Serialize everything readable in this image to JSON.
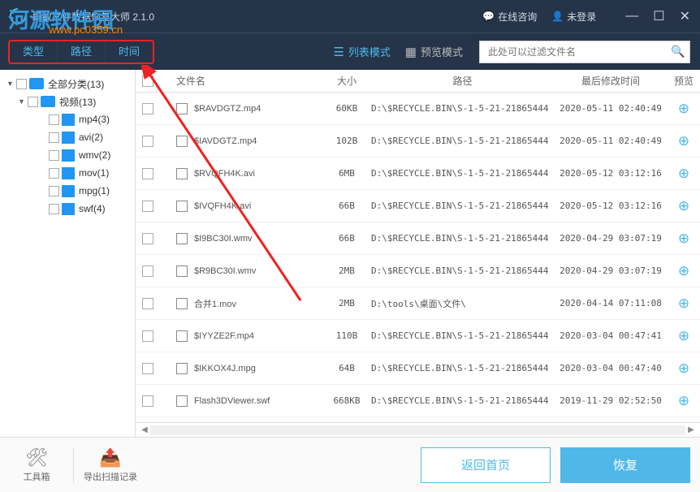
{
  "titlebar": {
    "title": "蚂蚁文件数据恢复大师 2.1.0",
    "online_consult": "在线咨询",
    "login_status": "未登录"
  },
  "watermark": {
    "main": "河源软件园",
    "url": "www.pc0359.cn"
  },
  "filter_tabs": [
    "类型",
    "路径",
    "时间"
  ],
  "modes": {
    "list": "列表模式",
    "preview": "预览模式"
  },
  "search": {
    "placeholder": "此处可以过滤文件名"
  },
  "tree": [
    {
      "depth": 0,
      "label": "全部分类(13)",
      "expanded": true,
      "class": "monitor"
    },
    {
      "depth": 1,
      "label": "视频(13)",
      "expanded": true,
      "class": "monitor"
    },
    {
      "depth": 2,
      "label": "mp4(3)"
    },
    {
      "depth": 2,
      "label": "avi(2)"
    },
    {
      "depth": 2,
      "label": "wmv(2)"
    },
    {
      "depth": 2,
      "label": "mov(1)"
    },
    {
      "depth": 2,
      "label": "mpg(1)"
    },
    {
      "depth": 2,
      "label": "swf(4)"
    }
  ],
  "columns": {
    "name": "文件名",
    "size": "大小",
    "path": "路径",
    "time": "最后修改时间",
    "preview": "预览"
  },
  "files": [
    {
      "name": "$RAVDGTZ.mp4",
      "size": "60KB",
      "path": "D:\\$RECYCLE.BIN\\S-1-5-21-21865444",
      "time": "2020-05-11 02:40:49"
    },
    {
      "name": "$IAVDGTZ.mp4",
      "size": "102B",
      "path": "D:\\$RECYCLE.BIN\\S-1-5-21-21865444",
      "time": "2020-05-11 02:40:49"
    },
    {
      "name": "$RVQFH4K.avi",
      "size": "6MB",
      "path": "D:\\$RECYCLE.BIN\\S-1-5-21-21865444",
      "time": "2020-05-12 03:12:16"
    },
    {
      "name": "$IVQFH4K.avi",
      "size": "66B",
      "path": "D:\\$RECYCLE.BIN\\S-1-5-21-21865444",
      "time": "2020-05-12 03:12:16"
    },
    {
      "name": "$I9BC30I.wmv",
      "size": "66B",
      "path": "D:\\$RECYCLE.BIN\\S-1-5-21-21865444",
      "time": "2020-04-29 03:07:19"
    },
    {
      "name": "$R9BC30I.wmv",
      "size": "2MB",
      "path": "D:\\$RECYCLE.BIN\\S-1-5-21-21865444",
      "time": "2020-04-29 03:07:19"
    },
    {
      "name": "合并1.mov",
      "size": "2MB",
      "path": "D:\\tools\\桌面\\文件\\",
      "time": "2020-04-14 07:11:08"
    },
    {
      "name": "$IYYZE2F.mp4",
      "size": "110B",
      "path": "D:\\$RECYCLE.BIN\\S-1-5-21-21865444",
      "time": "2020-03-04 00:47:41"
    },
    {
      "name": "$IKKOX4J.mpg",
      "size": "64B",
      "path": "D:\\$RECYCLE.BIN\\S-1-5-21-21865444",
      "time": "2020-03-04 00:47:40"
    },
    {
      "name": "Flash3DViewer.swf",
      "size": "668KB",
      "path": "D:\\$RECYCLE.BIN\\S-1-5-21-21865444",
      "time": "2019-11-29 02:52:50"
    }
  ],
  "footer": {
    "toolbox": "工具箱",
    "export": "导出扫描记录",
    "home": "返回首页",
    "recover": "恢复"
  }
}
